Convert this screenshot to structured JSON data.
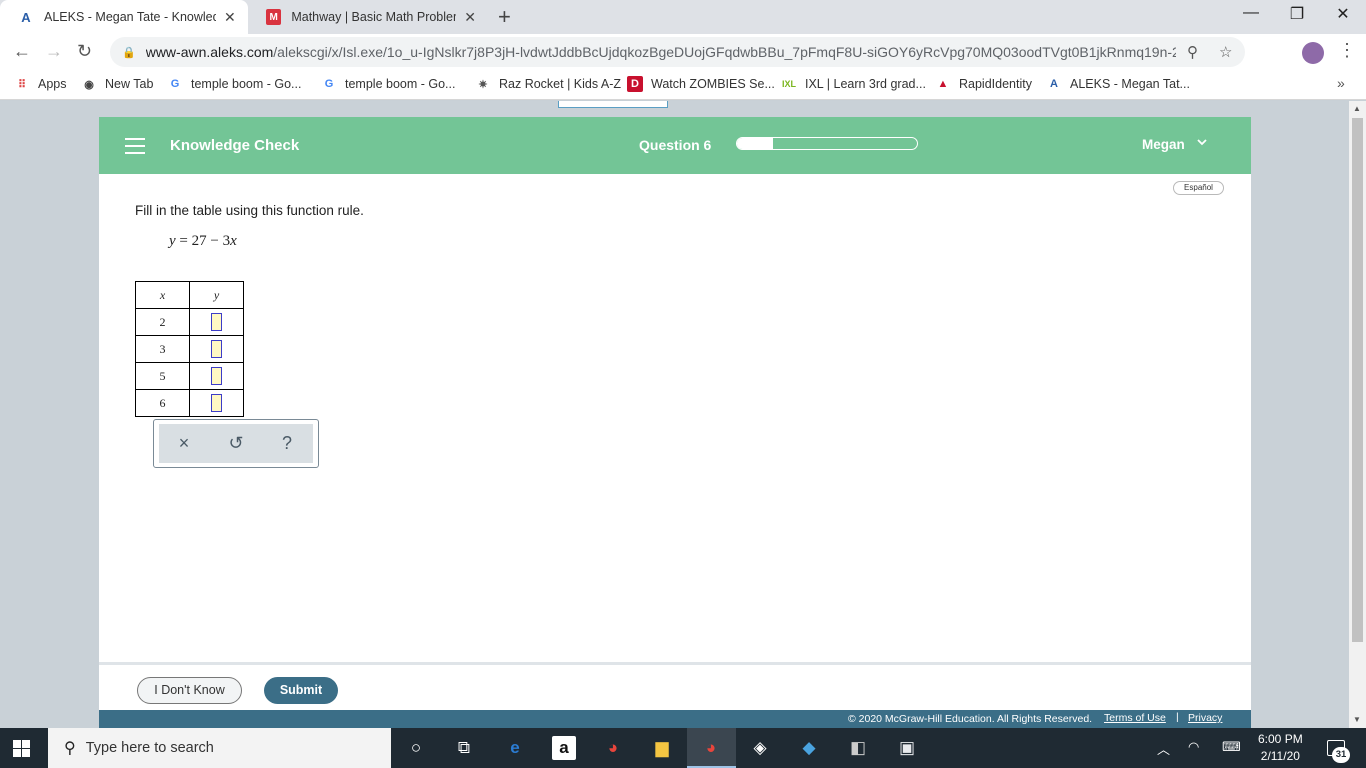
{
  "browser": {
    "tabs": [
      {
        "title": "ALEKS - Megan Tate - Knowledge",
        "active": true
      },
      {
        "title": "Mathway | Basic Math Problem S",
        "active": false
      }
    ],
    "url_domain": "www-awn.aleks.com",
    "url_path": "/alekscgi/x/Isl.exe/1o_u-IgNslkr7j8P3jH-lvdwtJddbBcUjdqkozBgeDUojGFqdwbBBu_7pFmqF8U-siGOY6yRcVpg70MQ03oodTVgt0B1jkRnmq19n-2u...",
    "bookmarks": [
      {
        "label": "Apps",
        "icon": "apps-grid-icon"
      },
      {
        "label": "New Tab",
        "icon": "globe-icon"
      },
      {
        "label": "temple boom - Go...",
        "icon": "google-icon"
      },
      {
        "label": "temple boom - Go...",
        "icon": "google-icon"
      },
      {
        "label": "Raz Rocket | Kids A-Z",
        "icon": "rocket-icon"
      },
      {
        "label": "Watch ZOMBIES Se...",
        "icon": "disney-icon"
      },
      {
        "label": "IXL | Learn 3rd grad...",
        "icon": "ixl-icon"
      },
      {
        "label": "RapidIdentity",
        "icon": "rapididentity-icon"
      },
      {
        "label": "ALEKS - Megan Tat...",
        "icon": "aleks-icon"
      }
    ]
  },
  "aleks": {
    "header": {
      "title": "Knowledge Check",
      "question_label": "Question 6",
      "progress_fraction": 0.2,
      "user_name": "Megan"
    },
    "language_toggle": "Español",
    "prompt": "Fill in the table using this function rule.",
    "rule": {
      "y": "y",
      "eq": "= 27 − 3",
      "x": "x"
    },
    "table": {
      "headers": [
        "x",
        "y"
      ],
      "x_values": [
        "2",
        "3",
        "5",
        "6"
      ]
    },
    "keypad": {
      "clear": "×",
      "undo": "↺",
      "help": "?"
    },
    "footer": {
      "idk_label": "I Don't Know",
      "submit_label": "Submit",
      "copyright": "© 2020 McGraw-Hill Education. All Rights Reserved.",
      "terms": "Terms of Use",
      "separator": "|",
      "privacy": "Privacy"
    },
    "colors": {
      "header_green": "#73c596",
      "brand_teal": "#3b6e87"
    }
  },
  "taskbar": {
    "search_placeholder": "Type here to search",
    "time": "6:00 PM",
    "date": "2/11/20",
    "notification_count": "31"
  }
}
